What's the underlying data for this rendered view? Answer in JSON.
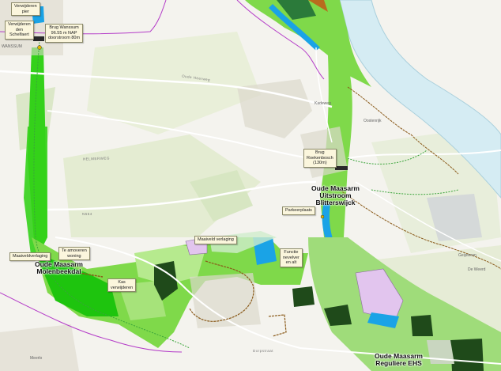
{
  "colors": {
    "background": "#f4f3ee",
    "river": "#d5ecf3",
    "river_edge": "#a9cfdc",
    "nature_green": "#7fd94a",
    "bright_green": "#34d11a",
    "dark_green": "#1f4a1a",
    "light_green": "#b6ea8e",
    "water_blue": "#1aa3e6",
    "lilac": "#e2c5ee",
    "admin_line": "#b43cc8",
    "road": "#ffffff",
    "route_brown": "#8a5a1a"
  },
  "callouts": {
    "verwijderen_pier": "Verwijderen\npier",
    "verwijderen_schelfaert": "Verwijderen\nden\nSchelfaert",
    "brug_wanssum": "Brug Wanssum\n96.55 m NAP\ndoorstroom 80m",
    "brug_roekenbosch": "Brug\nRoekenbosch\n(130m)",
    "parkeerplaats": "Parkeerplaats",
    "maaiveldverlaging_west": "Maaiveldverlaging",
    "te_amoveren_woning": "Te amoveren\nwoning",
    "kas_verwijderen": "Kas\nverwijderen",
    "maaiveldverlaging_mid": "Maaiveld verlaging",
    "functie_veranderen": "Functie\nnevelver\nen alt"
  },
  "area_labels": {
    "uitstroom": "Oude Maasarm\nUitstroom\nBlitterswijck",
    "molenbeekdal": "Oude Maasarm\nMolenbeekdal",
    "ehs": "Oude Maasarm\nReguliere EHS"
  },
  "streets": {
    "oude_heerweg": "Oude Heerweg",
    "n554": "N554",
    "meerlo": "Meerlo",
    "wanssum": "WANSSUM",
    "helmerweg": "HELMERWEG",
    "kadeweg": "Kadeweg",
    "oostenrijk": "Oostenrijk",
    "de_weerd": "De Weerd",
    "geijsteren": "Geijsteren",
    "dorpstraat": "Dorpstraat"
  }
}
